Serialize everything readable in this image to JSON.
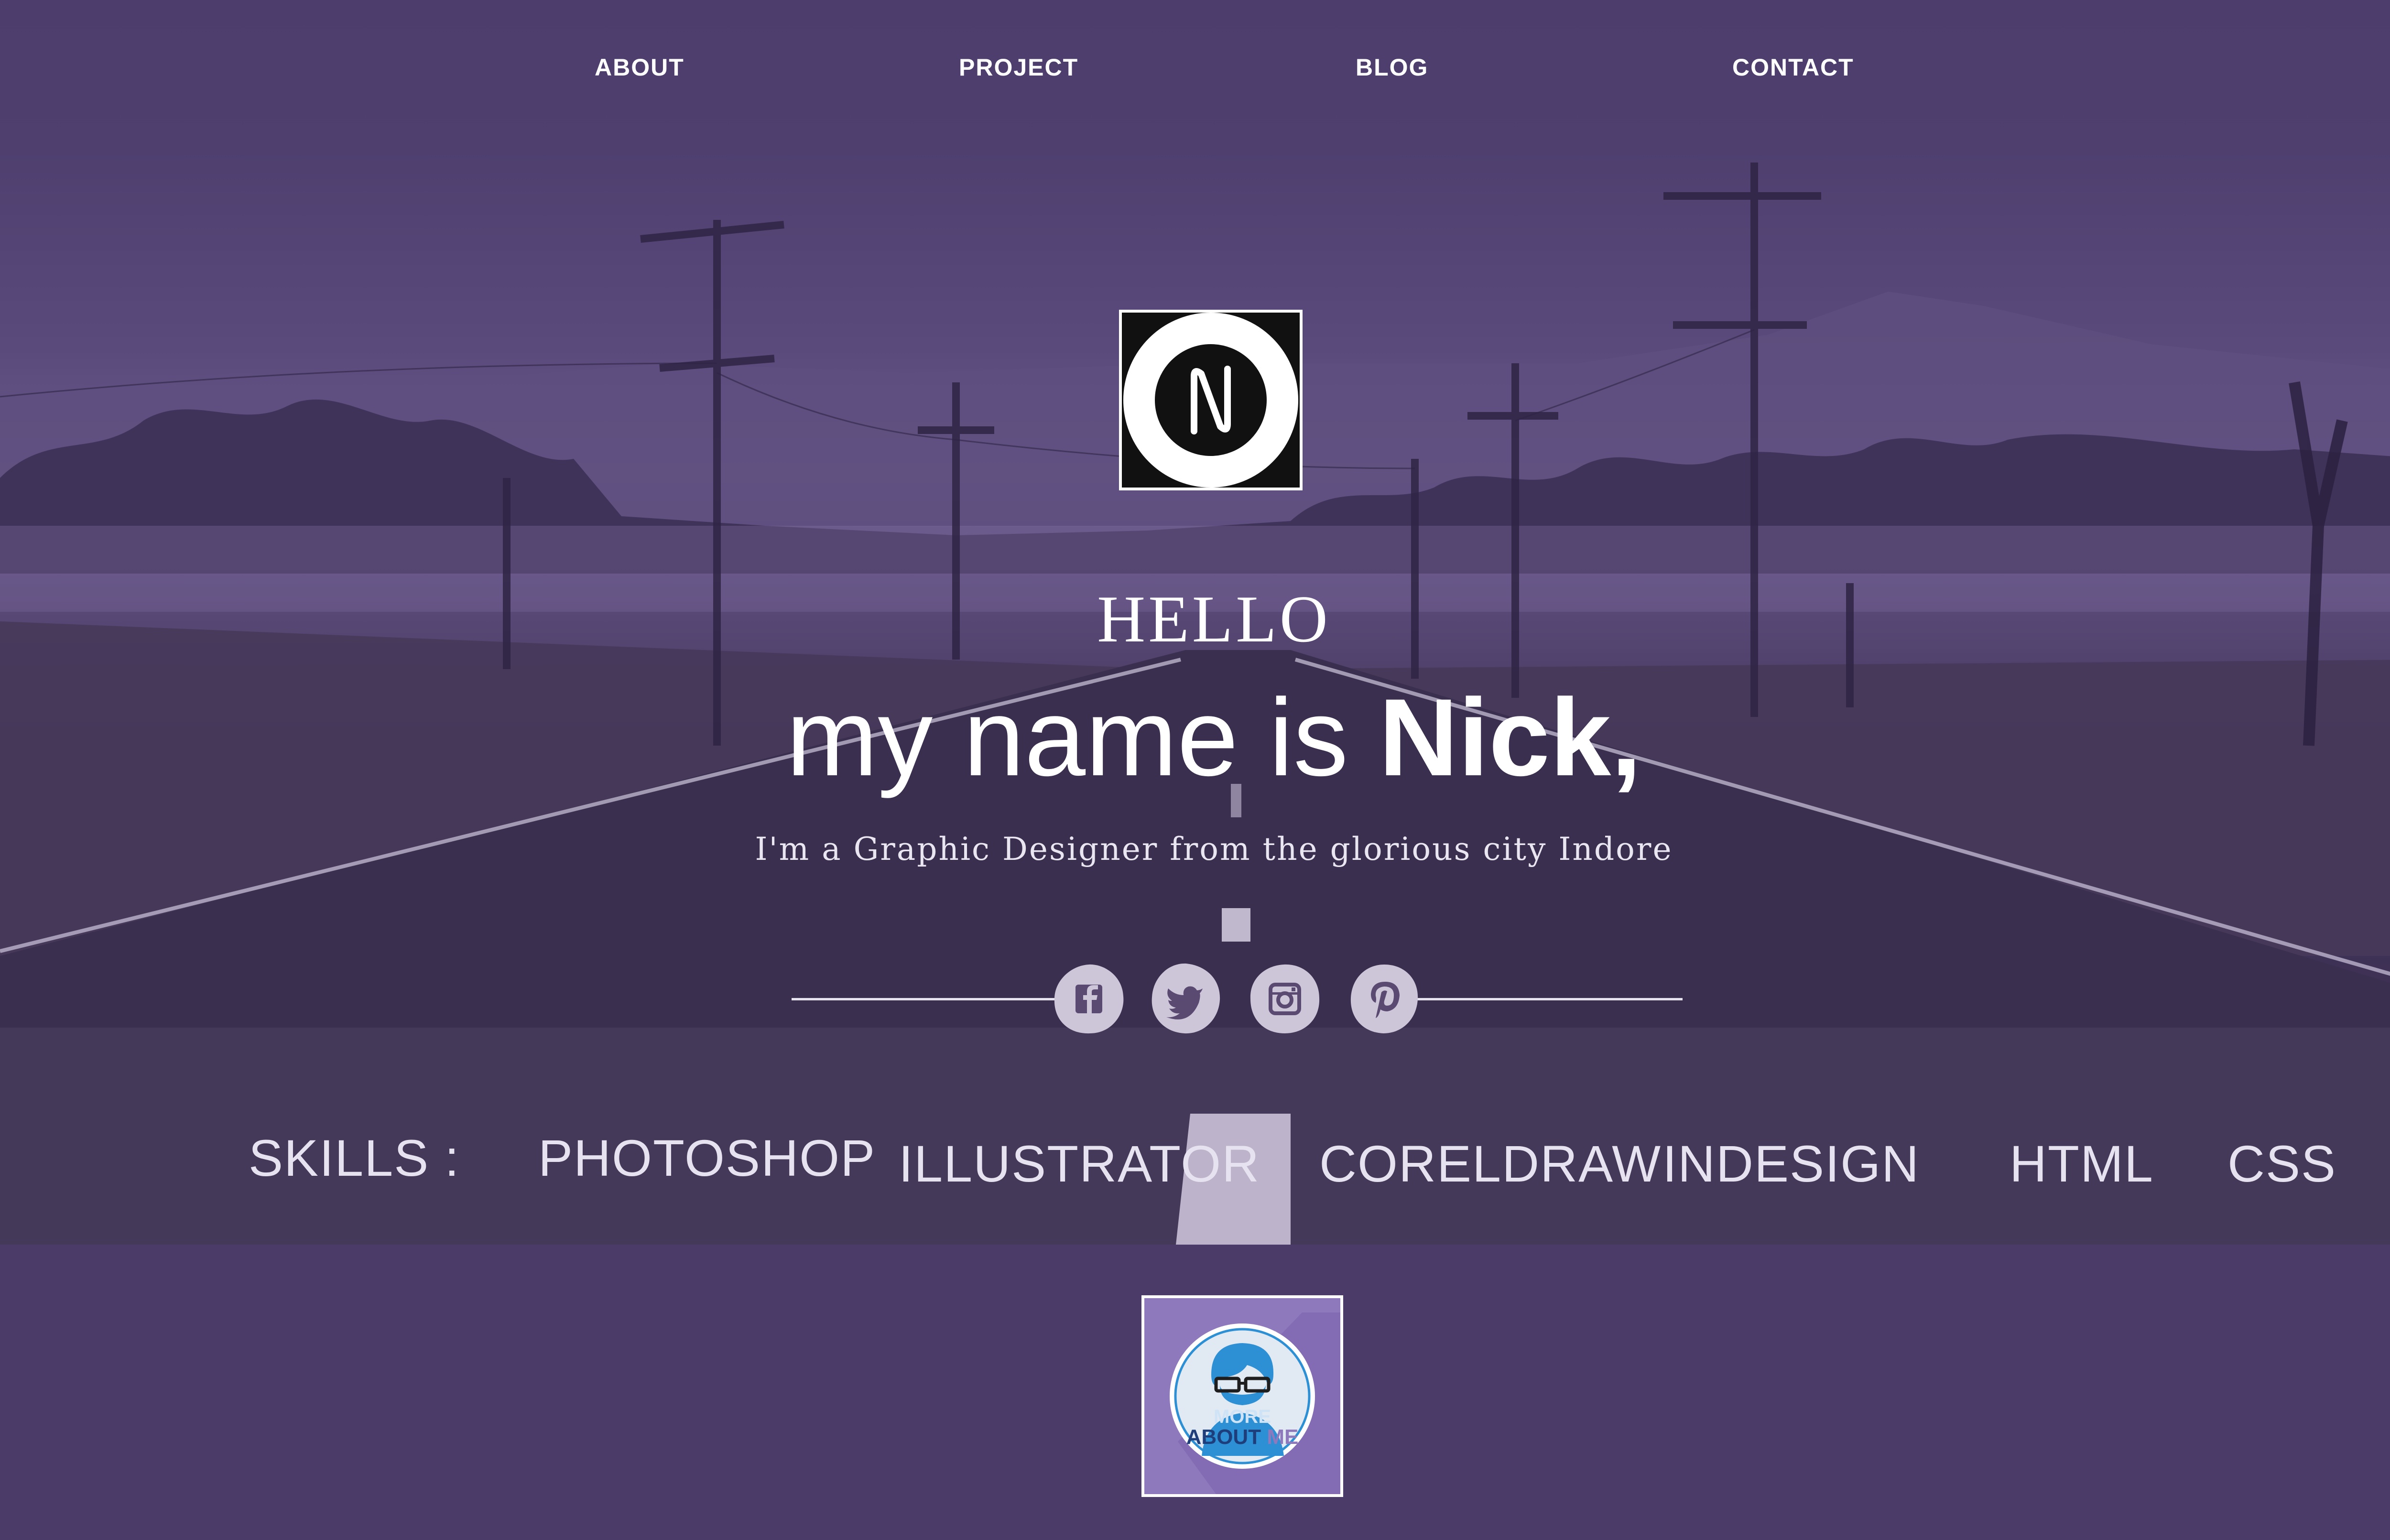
{
  "nav": {
    "items": [
      "ABOUT",
      "PROJECT",
      "BLOG",
      "CONTACT"
    ]
  },
  "logo": {
    "letter": "N",
    "icon": "logo-n-icon"
  },
  "hero": {
    "greeting": "HELLO",
    "headline_prefix": "my name is ",
    "headline_name": "Nick,",
    "tagline": "I'm a Graphic Designer from the glorious city Indore"
  },
  "social": [
    {
      "icon": "facebook-icon",
      "glyph": "f"
    },
    {
      "icon": "twitter-icon",
      "glyph": "t"
    },
    {
      "icon": "instagram-icon",
      "glyph": "ig"
    },
    {
      "icon": "pinterest-icon",
      "glyph": "p"
    }
  ],
  "skills": {
    "label": "SKILLS :",
    "items": [
      "PHOTOSHOP",
      "ILLUSTRATOR",
      "CORELDRAW",
      "INDESIGN",
      "HTML",
      "CSS"
    ]
  },
  "more_about": {
    "line1": "MORE",
    "line2_a": "ABOUT",
    "line2_b": "ME",
    "icon": "avatar-icon"
  },
  "colors": {
    "background": "#4b3b68",
    "hero_tint": "#5a4a7c",
    "text": "#ffffff",
    "badge": "#8f79bd",
    "avatar_blue": "#2d8fd4"
  }
}
